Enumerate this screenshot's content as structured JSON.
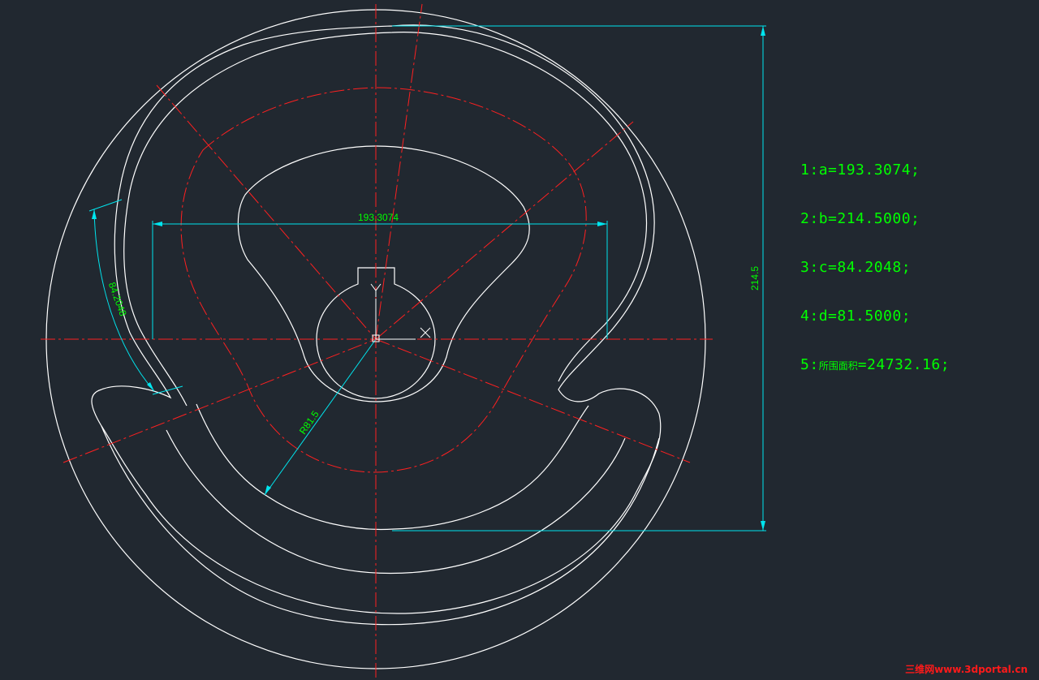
{
  "dimensions": {
    "horizontal": "193.3074",
    "vertical": "214.5",
    "arc_length": "84.2048",
    "radius": "R81.5"
  },
  "ucs": {
    "x_label": "X",
    "y_label": "Y"
  },
  "results": [
    {
      "index": "1:",
      "text": "a=193.3074;"
    },
    {
      "index": "2:",
      "text": "b=214.5000;"
    },
    {
      "index": "3:",
      "text": "c=84.2048;"
    },
    {
      "index": "4:",
      "text": "d=81.5000;"
    },
    {
      "index": "5:",
      "prefix": "所围面积",
      "text": "=24732.16;"
    }
  ],
  "watermark": "三维网www.3dportal.cn",
  "colors": {
    "background": "#212830",
    "geometry": "#ffffff",
    "centerline": "#ff2020",
    "dimension": "#00e5ee",
    "dimension_text": "#00ff00",
    "watermark": "#ff1a1a"
  }
}
